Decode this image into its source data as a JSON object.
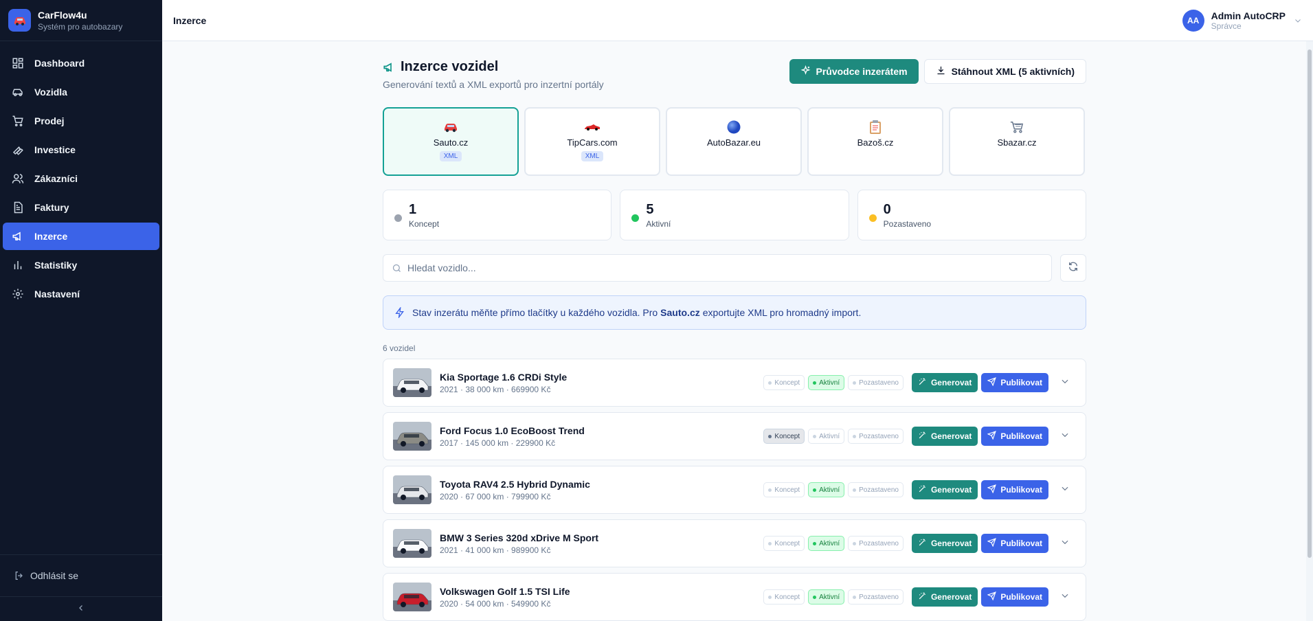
{
  "brand": {
    "name": "CarFlow4u",
    "subtitle": "Systém pro autobazary"
  },
  "sidebar": {
    "items": [
      {
        "label": "Dashboard",
        "icon": "dashboard-icon"
      },
      {
        "label": "Vozidla",
        "icon": "car-icon"
      },
      {
        "label": "Prodej",
        "icon": "cart-icon"
      },
      {
        "label": "Investice",
        "icon": "wrench-icon"
      },
      {
        "label": "Zákazníci",
        "icon": "users-icon"
      },
      {
        "label": "Faktury",
        "icon": "invoice-icon"
      },
      {
        "label": "Inzerce",
        "icon": "megaphone-icon",
        "active": true
      },
      {
        "label": "Statistiky",
        "icon": "chart-icon"
      },
      {
        "label": "Nastavení",
        "icon": "gear-icon"
      }
    ],
    "logout": "Odhlásit se"
  },
  "topbar": {
    "title": "Inzerce",
    "user": {
      "initials": "AA",
      "name": "Admin AutoCRP",
      "role": "Správce"
    }
  },
  "page": {
    "title": "Inzerce vozidel",
    "subtitle": "Generování textů a XML exportů pro inzertní portály",
    "wizard_label": "Průvodce inzerátem",
    "xml_label": "Stáhnout XML (5 aktivních)"
  },
  "portals": [
    {
      "name": "Sauto.cz",
      "badge": "XML",
      "active": true,
      "icon": "car-emoji-icon"
    },
    {
      "name": "TipCars.com",
      "badge": "XML",
      "icon": "racecar-emoji-icon"
    },
    {
      "name": "AutoBazar.eu",
      "badge": "",
      "icon": "globe-icon"
    },
    {
      "name": "Bazoš.cz",
      "badge": "",
      "icon": "clipboard-icon"
    },
    {
      "name": "Sbazar.cz",
      "badge": "",
      "icon": "cart-icon"
    }
  ],
  "stats": [
    {
      "value": "1",
      "label": "Koncept",
      "color": "#9ca3af"
    },
    {
      "value": "5",
      "label": "Aktivní",
      "color": "#22c55e"
    },
    {
      "value": "0",
      "label": "Pozastaveno",
      "color": "#fbbf24"
    }
  ],
  "search": {
    "placeholder": "Hledat vozidlo..."
  },
  "info": {
    "before": "Stav inzerátu měňte přímo tlačítky u každého vozidla. Pro",
    "bold": "Sauto.cz",
    "after": "exportujte XML pro hromadný import."
  },
  "list": {
    "count_label": "6 vozidel",
    "state_labels": {
      "draft": "Koncept",
      "active": "Aktivní",
      "paused": "Pozastaveno"
    },
    "generate_label": "Generovat",
    "publish_label": "Publikovat",
    "vehicles": [
      {
        "name": "Kia Sportage 1.6 CRDi Style",
        "meta": "2021 · 38 000 km · 669900 Kč",
        "state": "active",
        "car_color": "#f3f4f6"
      },
      {
        "name": "Ford Focus 1.0 EcoBoost Trend",
        "meta": "2017 · 145 000 km · 229900 Kč",
        "state": "draft",
        "car_color": "#8b8b85"
      },
      {
        "name": "Toyota RAV4 2.5 Hybrid Dynamic",
        "meta": "2020 · 67 000 km · 799900 Kč",
        "state": "active",
        "car_color": "#e5e7eb"
      },
      {
        "name": "BMW 3 Series 320d xDrive M Sport",
        "meta": "2021 · 41 000 km · 989900 Kč",
        "state": "active",
        "car_color": "#f9fafb"
      },
      {
        "name": "Volkswagen Golf 1.5 TSI Life",
        "meta": "2020 · 54 000 km · 549900 Kč",
        "state": "active",
        "car_color": "#c81e2b"
      }
    ]
  }
}
